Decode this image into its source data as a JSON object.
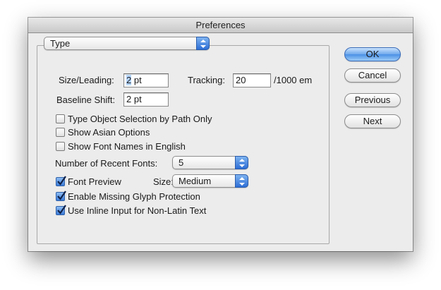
{
  "window": {
    "title": "Preferences"
  },
  "section_popup": {
    "value": "Type"
  },
  "fields": {
    "size_leading_label": "Size/Leading:",
    "size_leading_value_selected": "2",
    "size_leading_value_rest": " pt",
    "tracking_label": "Tracking:",
    "tracking_value": "20",
    "tracking_unit": "/1000 em",
    "baseline_shift_label": "Baseline Shift:",
    "baseline_shift_value": "2 pt"
  },
  "options": {
    "type_object_selection": {
      "label": "Type Object Selection by Path Only",
      "checked": false
    },
    "show_asian_options": {
      "label": "Show Asian Options",
      "checked": false
    },
    "show_font_names_english": {
      "label": "Show Font Names in English",
      "checked": false
    },
    "recent_fonts_label": "Number of Recent Fonts:",
    "recent_fonts_value": "5",
    "font_preview": {
      "label": "Font Preview",
      "checked": true
    },
    "size_label": "Size:",
    "size_value": "Medium",
    "missing_glyph": {
      "label": "Enable Missing Glyph Protection",
      "checked": true
    },
    "inline_input": {
      "label": "Use Inline Input for Non-Latin Text",
      "checked": true
    }
  },
  "buttons": {
    "ok": "OK",
    "cancel": "Cancel",
    "previous": "Previous",
    "next": "Next"
  },
  "colors": {
    "accent": "#3a7bd9",
    "selection": "#b5d5ff",
    "window_bg": "#ececec"
  }
}
